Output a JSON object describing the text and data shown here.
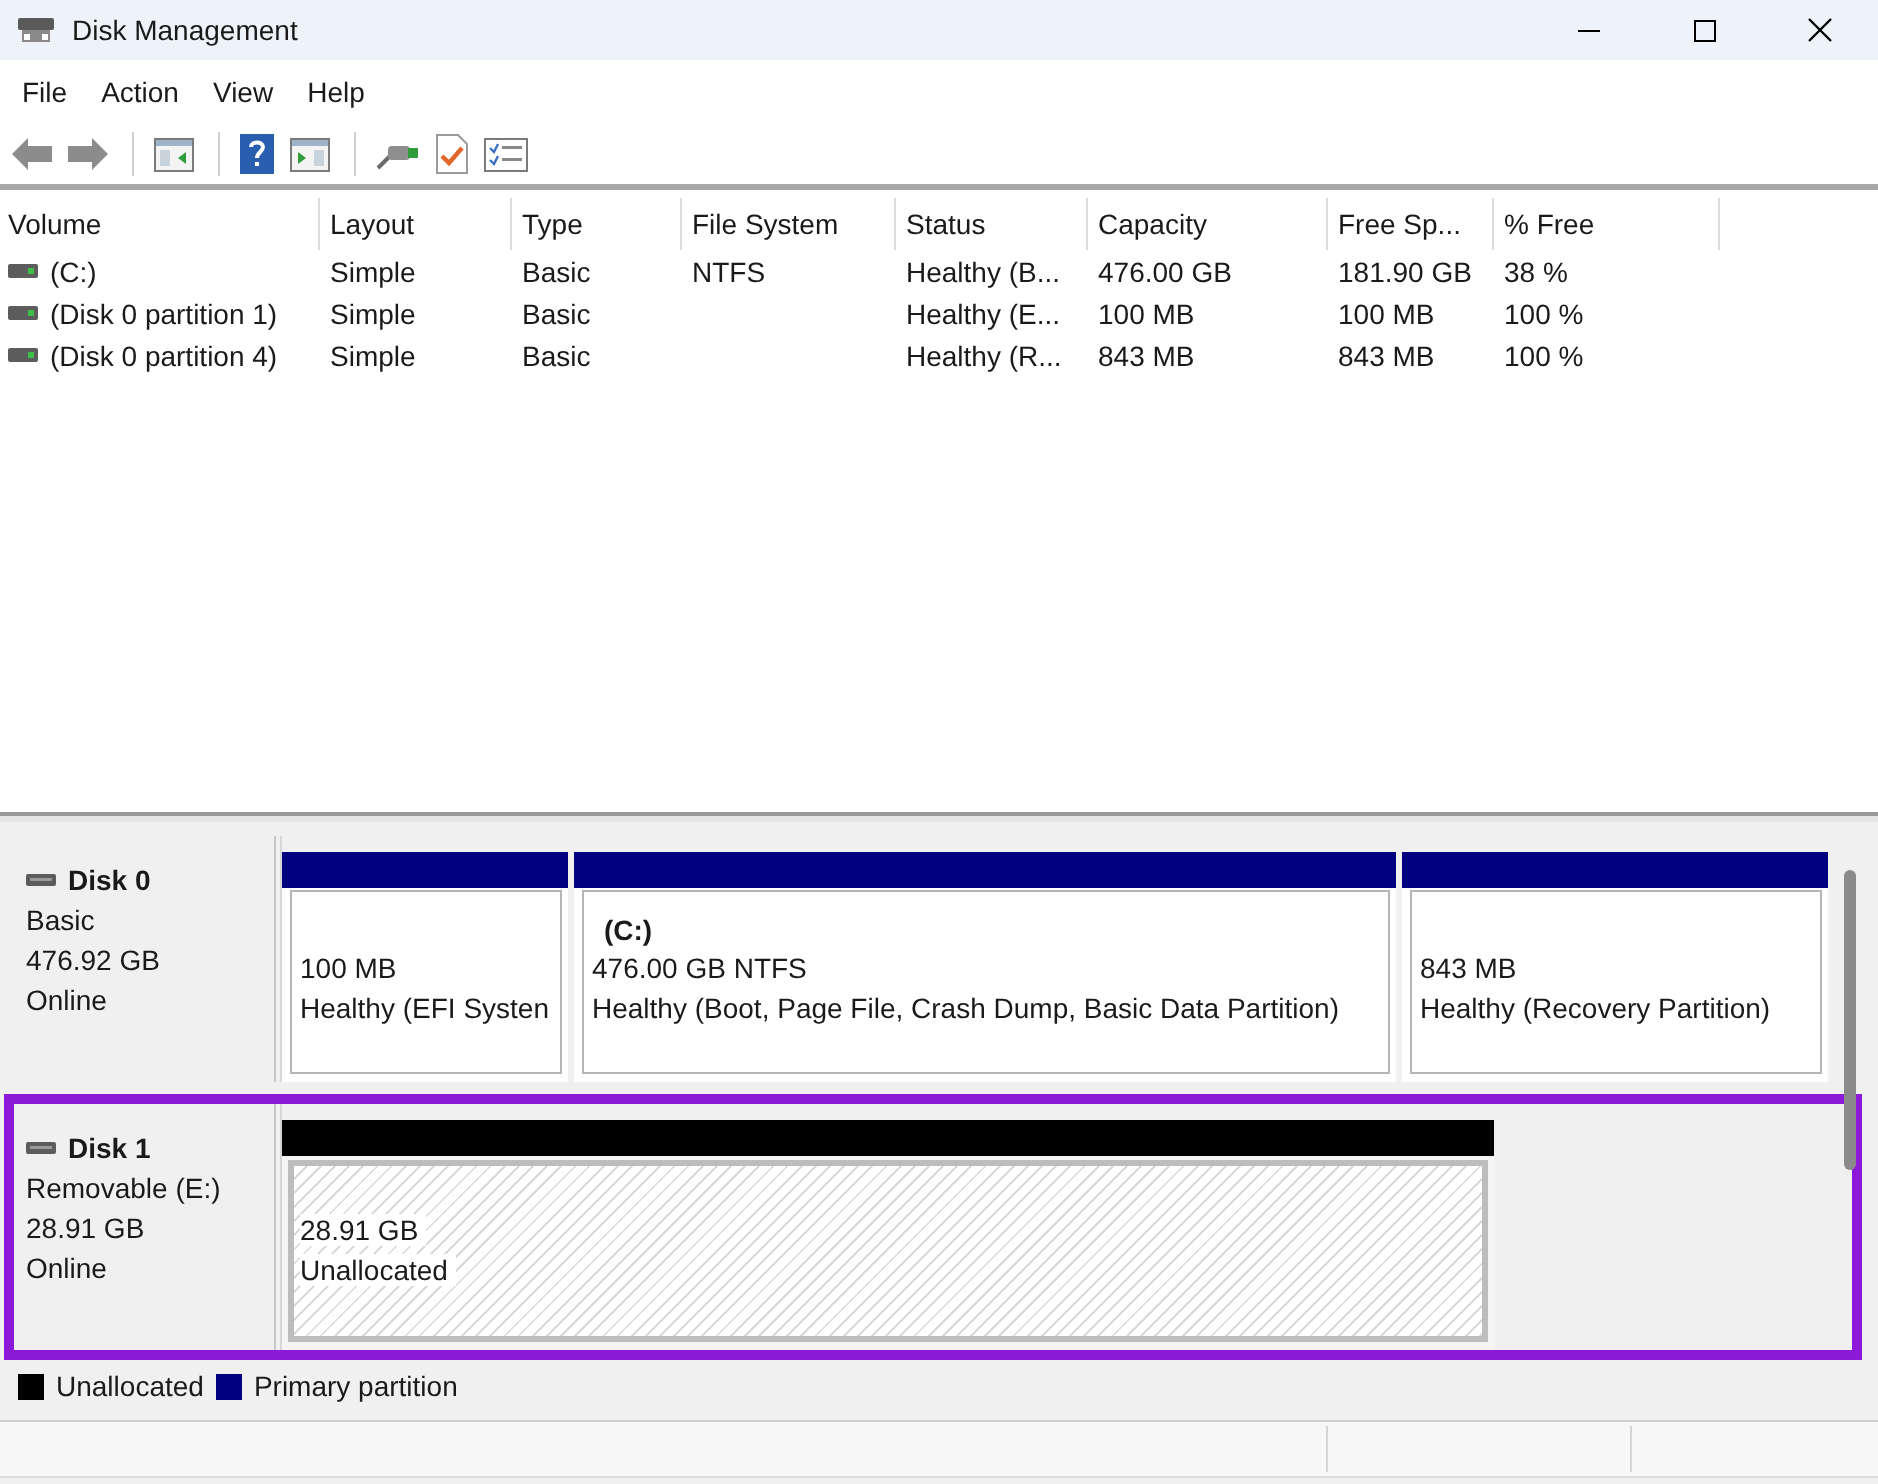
{
  "window": {
    "title": "Disk Management"
  },
  "menu": [
    "File",
    "Action",
    "View",
    "Help"
  ],
  "volume_list": {
    "columns": [
      "Volume",
      "Layout",
      "Type",
      "File System",
      "Status",
      "Capacity",
      "Free Sp...",
      "% Free"
    ],
    "rows": [
      {
        "volume": "(C:)",
        "layout": "Simple",
        "type": "Basic",
        "file_system": "NTFS",
        "status": "Healthy (B...",
        "capacity": "476.00 GB",
        "free_space": "181.90 GB",
        "percent_free": "38 %"
      },
      {
        "volume": "(Disk 0 partition 1)",
        "layout": "Simple",
        "type": "Basic",
        "status": "Healthy (E...",
        "capacity": "100 MB",
        "free_space": "100 MB",
        "percent_free": "100 %"
      },
      {
        "volume": "(Disk 0 partition 4)",
        "layout": "Simple",
        "type": "Basic",
        "status": "Healthy (R...",
        "capacity": "843 MB",
        "free_space": "843 MB",
        "percent_free": "100 %"
      }
    ]
  },
  "disks": [
    {
      "name": "Disk 0",
      "type": "Basic",
      "size": "476.92 GB",
      "status": "Online",
      "highlighted": false,
      "partitions": [
        {
          "kind": "primary",
          "size": "100 MB",
          "status": "Healthy (EFI Systen"
        },
        {
          "kind": "primary",
          "label": "(C:)",
          "size": "476.00 GB NTFS",
          "status": "Healthy (Boot, Page File, Crash Dump, Basic Data Partition)"
        },
        {
          "kind": "primary",
          "size": "843 MB",
          "status": "Healthy (Recovery Partition)"
        }
      ]
    },
    {
      "name": "Disk 1",
      "type": "Removable (E:)",
      "size": "28.91 GB",
      "status": "Online",
      "highlighted": true,
      "partitions": [
        {
          "kind": "unallocated",
          "size": "28.91 GB",
          "status": "Unallocated"
        }
      ]
    }
  ],
  "legend": [
    {
      "kind": "unallocated",
      "label": "Unallocated",
      "color": "#000000"
    },
    {
      "kind": "primary",
      "label": "Primary partition",
      "color": "#000080"
    }
  ]
}
